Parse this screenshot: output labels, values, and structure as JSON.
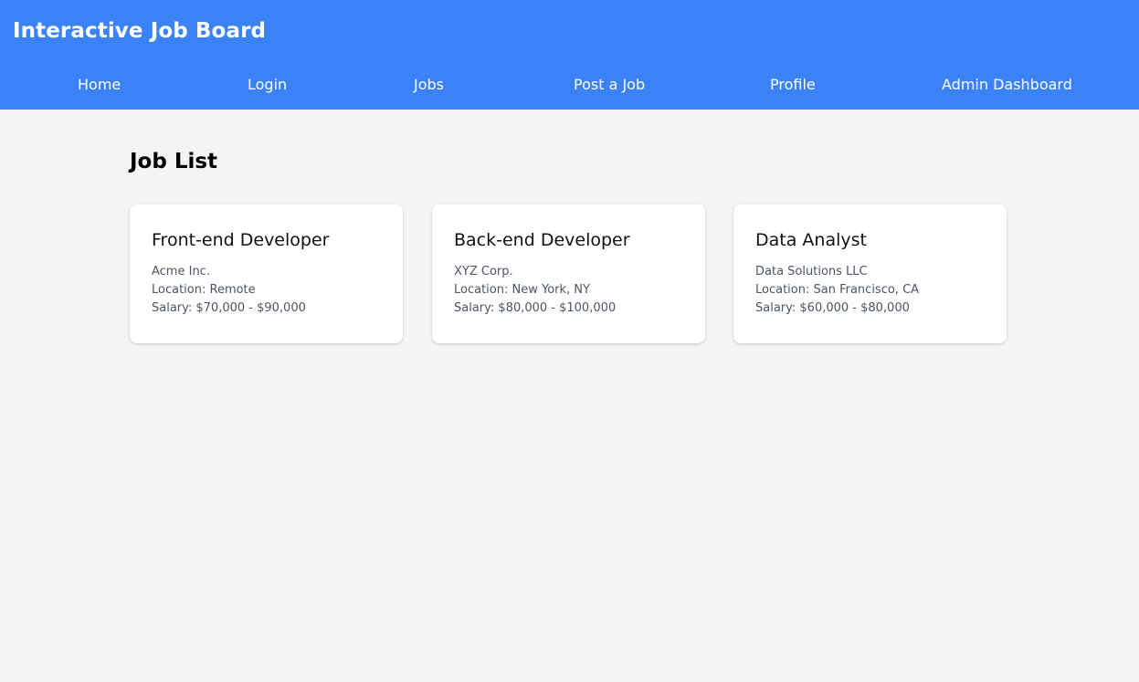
{
  "header": {
    "title": "Interactive Job Board",
    "background_color": "#3b82f6",
    "text_color": "#ffffff"
  },
  "nav": {
    "items": [
      {
        "label": "Home"
      },
      {
        "label": "Login"
      },
      {
        "label": "Jobs"
      },
      {
        "label": "Post a Job"
      },
      {
        "label": "Profile"
      },
      {
        "label": "Admin Dashboard"
      }
    ]
  },
  "main": {
    "title": "Job List",
    "background_color": "#f3f4f6",
    "jobs": [
      {
        "title": "Front-end Developer",
        "company": "Acme Inc.",
        "location": "Location: Remote",
        "salary": "Salary: $70,000 - $90,000"
      },
      {
        "title": "Back-end Developer",
        "company": "XYZ Corp.",
        "location": "Location: New York, NY",
        "salary": "Salary: $80,000 - $100,000"
      },
      {
        "title": "Data Analyst",
        "company": "Data Solutions LLC",
        "location": "Location: San Francisco, CA",
        "salary": "Salary: $60,000 - $80,000"
      }
    ]
  }
}
